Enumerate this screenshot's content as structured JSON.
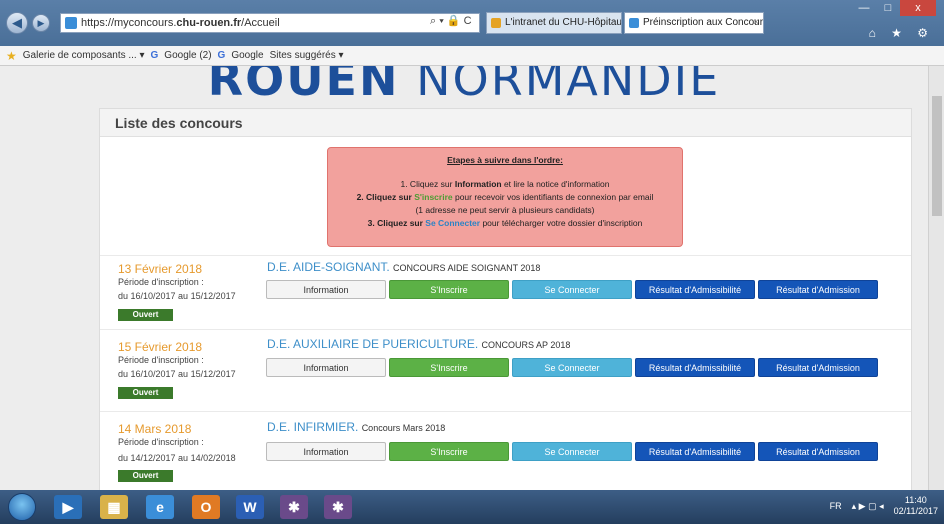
{
  "browser": {
    "url_prefix": "https://myconcours.",
    "url_domain": "chu-rouen.fr",
    "url_path": "/Accueil",
    "addr_tools": "⌕ ▾ 🔒 C",
    "tabs": [
      {
        "label": "L'intranet du CHU-Hôpitaux d..."
      },
      {
        "label": "Préinscription aux Concour..."
      }
    ],
    "tab_close": "×",
    "window_controls": [
      "—",
      "□",
      "x"
    ],
    "toolbar_icons": "⌂ ★ ⚙"
  },
  "favorites": {
    "star": "★",
    "items": [
      {
        "label": "Galerie de composants ... ▾"
      },
      {
        "label": "Google (2)"
      },
      {
        "label": "Google"
      },
      {
        "label": "Sites suggérés ▾"
      }
    ]
  },
  "page": {
    "brand_bold": "ROUEN",
    "brand_light": "NORMANDIE",
    "panel_title": "Liste des concours",
    "notice": {
      "title": "Etapes à suivre dans l'ordre:",
      "l1_a": "1. Cliquez sur ",
      "l1_b": "Information",
      "l1_c": " et lire la notice d'information",
      "l2_a": "2. Cliquez sur ",
      "l2_b": "S'inscrire",
      "l2_c": " pour recevoir vos identifiants de connexion par email",
      "l3": "(1 adresse ne peut servir à plusieurs candidats)",
      "l4_a": "3. Cliquez sur ",
      "l4_b": "Se Connecter",
      "l4_c": " pour télécharger votre dossier d'inscription"
    },
    "concours": [
      {
        "date": "13 Février 2018",
        "period_label": "Période d'inscription :",
        "period": "du 16/10/2017 au 15/12/2017",
        "status": "Ouvert",
        "title": "D.E. AIDE-SOIGNANT.",
        "subtitle": "CONCOURS AIDE SOIGNANT 2018"
      },
      {
        "date": "15 Février 2018",
        "period_label": "Période d'inscription :",
        "period": "du 16/10/2017 au 15/12/2017",
        "status": "Ouvert",
        "title": "D.E. AUXILIAIRE DE PUERICULTURE.",
        "subtitle": "CONCOURS AP 2018"
      },
      {
        "date": "14 Mars 2018",
        "period_label": "Période d'inscription :",
        "period": "du 14/12/2017 au 14/02/2018",
        "status": "Ouvert",
        "title": "D.E. INFIRMIER.",
        "subtitle": "Concours Mars 2018"
      }
    ],
    "buttons": {
      "information": "Information",
      "inscrire": "S'Inscrire",
      "connecter": "Se Connecter",
      "admissibilite": "Résultat d'Admissibilité",
      "admission": "Résultat d'Admission"
    }
  },
  "taskbar": {
    "lang": "FR",
    "tray_icons": "▴ ▶ ▢ ◂",
    "time": "11:40",
    "date": "02/11/2017"
  },
  "colors": {
    "brand": "#1d4f9a",
    "date_orange": "#e69a2e",
    "badge_green": "#3b7a2b",
    "btn_green": "#5cb146",
    "btn_lightblue": "#4fb3d9",
    "btn_darkblue": "#1455b8",
    "notice_bg": "#f2a19d"
  }
}
